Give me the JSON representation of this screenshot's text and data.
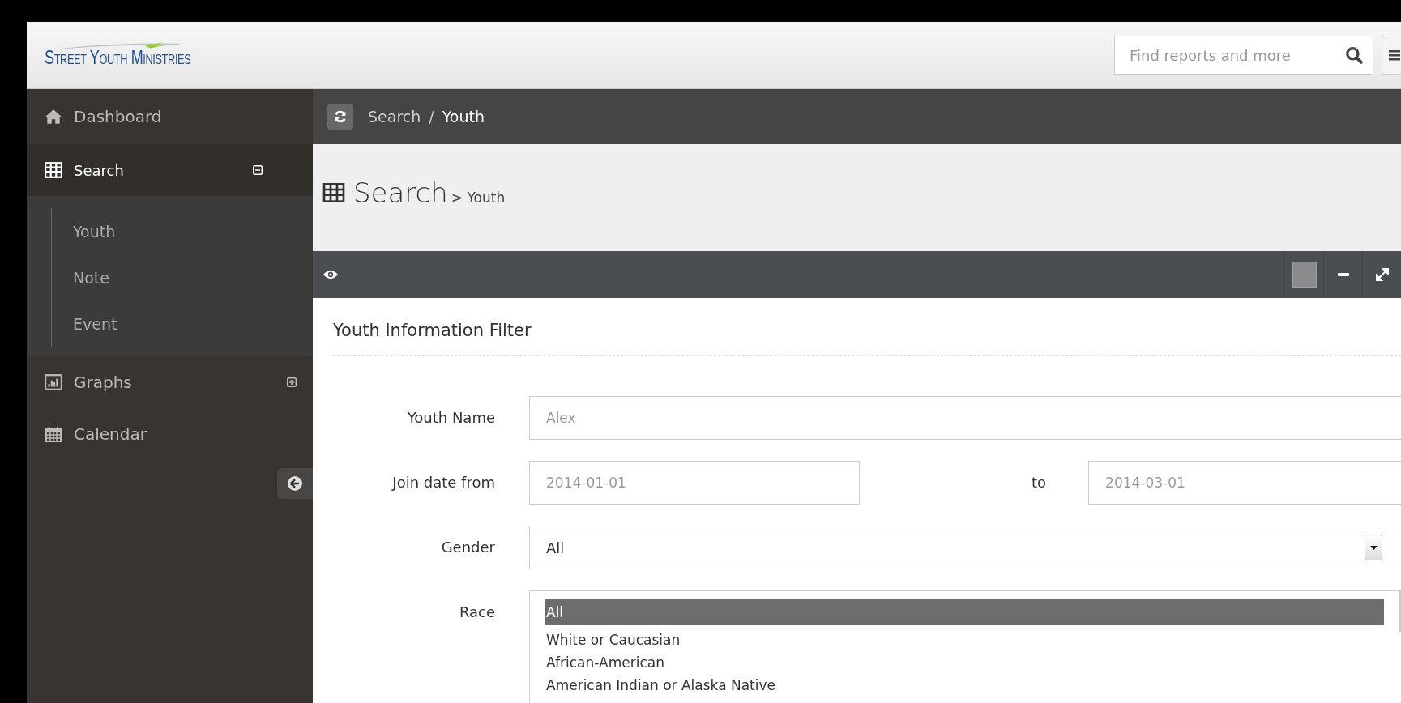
{
  "brand": {
    "name": "Street Youth Ministries"
  },
  "search": {
    "placeholder": "Find reports and more"
  },
  "sidebar": {
    "items": [
      {
        "label": "Dashboard",
        "kind": "home",
        "selected": false
      },
      {
        "label": "Search",
        "kind": "table",
        "selected": true,
        "expanded": true,
        "children": [
          {
            "label": "Youth",
            "selected": false
          },
          {
            "label": "Note",
            "selected": false
          },
          {
            "label": "Event",
            "selected": false
          }
        ]
      },
      {
        "label": "Graphs",
        "kind": "chart",
        "selected": false,
        "expanded": false
      },
      {
        "label": "Calendar",
        "kind": "calendar",
        "selected": false
      }
    ]
  },
  "breadcrumb": {
    "separator": "/",
    "items": [
      {
        "label": "Search",
        "current": false
      },
      {
        "label": "Youth",
        "current": true
      }
    ]
  },
  "page_title": {
    "title": "Search",
    "subtitle": "> Youth"
  },
  "panel": {
    "title": "Youth Information Filter",
    "fields": [
      {
        "kind": "text",
        "label": "Youth Name",
        "placeholder": "Alex"
      },
      {
        "kind": "daterange",
        "label": "Join date from",
        "placeholder": "2014-01-01",
        "separator": "to",
        "placeholder_to": "2014-03-01"
      },
      {
        "kind": "select",
        "label": "Gender",
        "value": "All"
      },
      {
        "kind": "listbox",
        "label": "Race",
        "options": [
          {
            "label": "All",
            "selected": true
          },
          {
            "label": "White or Caucasian",
            "selected": false
          },
          {
            "label": "African-American",
            "selected": false
          },
          {
            "label": "American Indian or Alaska Native",
            "selected": false
          }
        ]
      }
    ]
  }
}
